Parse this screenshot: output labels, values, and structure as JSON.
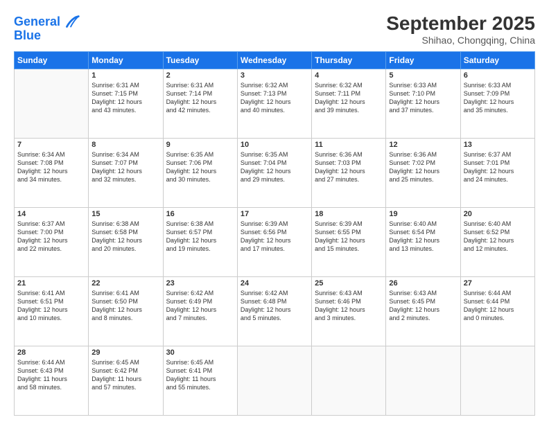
{
  "header": {
    "logo_line1": "General",
    "logo_line2": "Blue",
    "month": "September 2025",
    "location": "Shihao, Chongqing, China"
  },
  "weekdays": [
    "Sunday",
    "Monday",
    "Tuesday",
    "Wednesday",
    "Thursday",
    "Friday",
    "Saturday"
  ],
  "weeks": [
    [
      {
        "day": "",
        "info": ""
      },
      {
        "day": "1",
        "info": "Sunrise: 6:31 AM\nSunset: 7:15 PM\nDaylight: 12 hours\nand 43 minutes."
      },
      {
        "day": "2",
        "info": "Sunrise: 6:31 AM\nSunset: 7:14 PM\nDaylight: 12 hours\nand 42 minutes."
      },
      {
        "day": "3",
        "info": "Sunrise: 6:32 AM\nSunset: 7:13 PM\nDaylight: 12 hours\nand 40 minutes."
      },
      {
        "day": "4",
        "info": "Sunrise: 6:32 AM\nSunset: 7:11 PM\nDaylight: 12 hours\nand 39 minutes."
      },
      {
        "day": "5",
        "info": "Sunrise: 6:33 AM\nSunset: 7:10 PM\nDaylight: 12 hours\nand 37 minutes."
      },
      {
        "day": "6",
        "info": "Sunrise: 6:33 AM\nSunset: 7:09 PM\nDaylight: 12 hours\nand 35 minutes."
      }
    ],
    [
      {
        "day": "7",
        "info": "Sunrise: 6:34 AM\nSunset: 7:08 PM\nDaylight: 12 hours\nand 34 minutes."
      },
      {
        "day": "8",
        "info": "Sunrise: 6:34 AM\nSunset: 7:07 PM\nDaylight: 12 hours\nand 32 minutes."
      },
      {
        "day": "9",
        "info": "Sunrise: 6:35 AM\nSunset: 7:06 PM\nDaylight: 12 hours\nand 30 minutes."
      },
      {
        "day": "10",
        "info": "Sunrise: 6:35 AM\nSunset: 7:04 PM\nDaylight: 12 hours\nand 29 minutes."
      },
      {
        "day": "11",
        "info": "Sunrise: 6:36 AM\nSunset: 7:03 PM\nDaylight: 12 hours\nand 27 minutes."
      },
      {
        "day": "12",
        "info": "Sunrise: 6:36 AM\nSunset: 7:02 PM\nDaylight: 12 hours\nand 25 minutes."
      },
      {
        "day": "13",
        "info": "Sunrise: 6:37 AM\nSunset: 7:01 PM\nDaylight: 12 hours\nand 24 minutes."
      }
    ],
    [
      {
        "day": "14",
        "info": "Sunrise: 6:37 AM\nSunset: 7:00 PM\nDaylight: 12 hours\nand 22 minutes."
      },
      {
        "day": "15",
        "info": "Sunrise: 6:38 AM\nSunset: 6:58 PM\nDaylight: 12 hours\nand 20 minutes."
      },
      {
        "day": "16",
        "info": "Sunrise: 6:38 AM\nSunset: 6:57 PM\nDaylight: 12 hours\nand 19 minutes."
      },
      {
        "day": "17",
        "info": "Sunrise: 6:39 AM\nSunset: 6:56 PM\nDaylight: 12 hours\nand 17 minutes."
      },
      {
        "day": "18",
        "info": "Sunrise: 6:39 AM\nSunset: 6:55 PM\nDaylight: 12 hours\nand 15 minutes."
      },
      {
        "day": "19",
        "info": "Sunrise: 6:40 AM\nSunset: 6:54 PM\nDaylight: 12 hours\nand 13 minutes."
      },
      {
        "day": "20",
        "info": "Sunrise: 6:40 AM\nSunset: 6:52 PM\nDaylight: 12 hours\nand 12 minutes."
      }
    ],
    [
      {
        "day": "21",
        "info": "Sunrise: 6:41 AM\nSunset: 6:51 PM\nDaylight: 12 hours\nand 10 minutes."
      },
      {
        "day": "22",
        "info": "Sunrise: 6:41 AM\nSunset: 6:50 PM\nDaylight: 12 hours\nand 8 minutes."
      },
      {
        "day": "23",
        "info": "Sunrise: 6:42 AM\nSunset: 6:49 PM\nDaylight: 12 hours\nand 7 minutes."
      },
      {
        "day": "24",
        "info": "Sunrise: 6:42 AM\nSunset: 6:48 PM\nDaylight: 12 hours\nand 5 minutes."
      },
      {
        "day": "25",
        "info": "Sunrise: 6:43 AM\nSunset: 6:46 PM\nDaylight: 12 hours\nand 3 minutes."
      },
      {
        "day": "26",
        "info": "Sunrise: 6:43 AM\nSunset: 6:45 PM\nDaylight: 12 hours\nand 2 minutes."
      },
      {
        "day": "27",
        "info": "Sunrise: 6:44 AM\nSunset: 6:44 PM\nDaylight: 12 hours\nand 0 minutes."
      }
    ],
    [
      {
        "day": "28",
        "info": "Sunrise: 6:44 AM\nSunset: 6:43 PM\nDaylight: 11 hours\nand 58 minutes."
      },
      {
        "day": "29",
        "info": "Sunrise: 6:45 AM\nSunset: 6:42 PM\nDaylight: 11 hours\nand 57 minutes."
      },
      {
        "day": "30",
        "info": "Sunrise: 6:45 AM\nSunset: 6:41 PM\nDaylight: 11 hours\nand 55 minutes."
      },
      {
        "day": "",
        "info": ""
      },
      {
        "day": "",
        "info": ""
      },
      {
        "day": "",
        "info": ""
      },
      {
        "day": "",
        "info": ""
      }
    ]
  ]
}
